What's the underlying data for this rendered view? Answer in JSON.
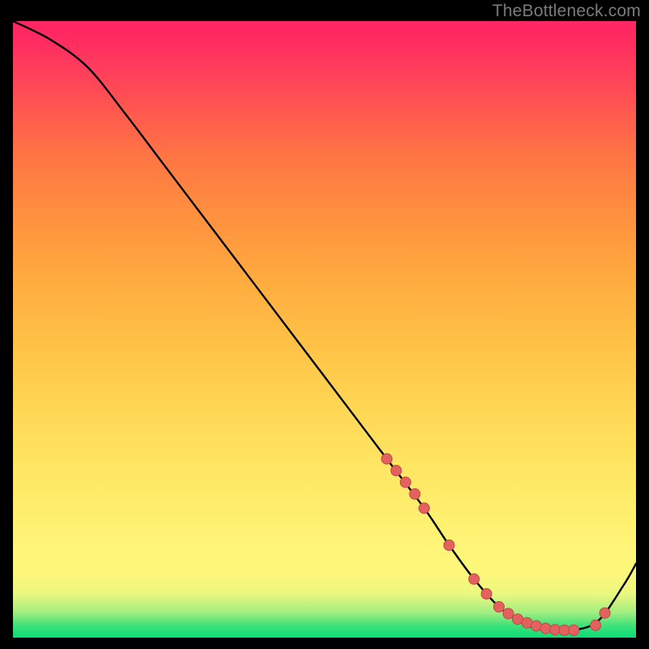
{
  "watermark": "TheBottleneck.com",
  "colors": {
    "background": "#000000",
    "curve_stroke": "#000000",
    "marker_fill": "#e36260",
    "marker_stroke": "#c24845"
  },
  "chart_data": {
    "type": "line",
    "title": "",
    "xlabel": "",
    "ylabel": "",
    "xlim": [
      0,
      100
    ],
    "ylim": [
      0,
      100
    ],
    "grid": false,
    "legend": false,
    "x": [
      0,
      6,
      12,
      18,
      24,
      30,
      36,
      42,
      48,
      54,
      60,
      66,
      70,
      74,
      78,
      82,
      86,
      90,
      94,
      98,
      100
    ],
    "values": [
      100,
      97,
      92.5,
      85,
      77,
      69,
      61,
      53,
      45,
      37,
      29,
      21,
      15,
      9.5,
      5,
      2.2,
      1.2,
      1.2,
      2.8,
      8.5,
      12
    ],
    "markers_x": [
      60,
      61.5,
      63,
      64.5,
      66,
      70,
      74,
      76,
      78,
      79.5,
      81,
      82.5,
      84,
      85.5,
      87,
      88.5,
      90,
      93.5,
      95
    ],
    "markers_y": [
      29,
      27.1,
      25.2,
      23.3,
      21,
      15,
      9.5,
      7.1,
      5.0,
      3.9,
      3.0,
      2.4,
      1.9,
      1.5,
      1.3,
      1.2,
      1.2,
      2.0,
      4.0
    ]
  }
}
